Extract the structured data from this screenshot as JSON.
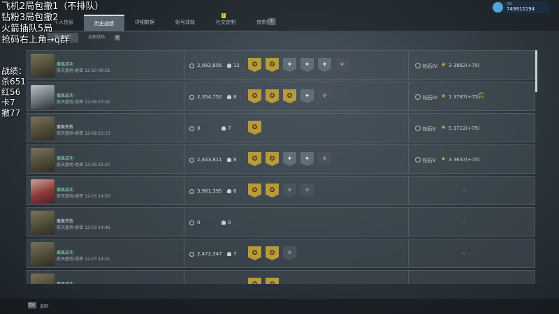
{
  "overlay_lines": [
    "飞机2局包撤1（不排队）",
    "钻粉3局包撤2",
    "火箭插队5局",
    "抢码右上角→q群"
  ],
  "stats_lines": [
    "战绩：",
    "杀651",
    "红56",
    "卡7",
    "撤77"
  ],
  "user": {
    "label": "QQ",
    "id": "749912194"
  },
  "tabs": [
    "个人信息",
    "历史战绩",
    "详细数据",
    "账号成就",
    "社交定制",
    "借贵档案"
  ],
  "subtabs": [
    "烽火地带",
    "全面战场"
  ],
  "footer": {
    "esc_key": "Esc",
    "label": "返回"
  },
  "matches": [
    {
      "avatar": "soldier",
      "status": "撤离成功",
      "map": "航天基地-绝密",
      "date": "12-10 00:01",
      "money": "2,092,856",
      "kills": "12",
      "badges": [
        "gold",
        "gold",
        "silver",
        "silver",
        "silver",
        "dark"
      ],
      "rank": "钻石IV",
      "stars": "3",
      "points": "3862(+75)",
      "chevrons": false
    },
    {
      "avatar": "mask",
      "status": "撤离成功",
      "map": "航天基地-绝密",
      "date": "12-09 23:32",
      "money": "2,354,752",
      "kills": "8",
      "badges": [
        "gold",
        "gold",
        "gold",
        "silver",
        "dark"
      ],
      "rank": "钻石IV",
      "stars": "1",
      "points": "3787(+75)",
      "chevrons": true
    },
    {
      "avatar": "soldier",
      "status": "撤离失败",
      "map": "航天基地-绝密",
      "date": "12-09 23:13",
      "money": "0",
      "kills": "7",
      "badges": [
        "gold"
      ],
      "rank": "钻石V",
      "stars": "5",
      "points": "3712(+75)",
      "chevrons": false
    },
    {
      "avatar": "soldier",
      "status": "撤离成功",
      "map": "航天基地-绝密",
      "date": "12-09 22:37",
      "money": "2,443,811",
      "kills": "8",
      "badges": [
        "gold",
        "gold",
        "silver",
        "silver",
        "dark"
      ],
      "rank": "钻石V",
      "stars": "3",
      "points": "3637(+75)",
      "chevrons": false
    },
    {
      "avatar": "girl",
      "status": "撤离成功",
      "map": "航天基地-绝密",
      "date": "12-03 14:50",
      "money": "3,961,395",
      "kills": "6",
      "badges": [
        "gold",
        "gold",
        "dark",
        "dark"
      ],
      "rank": "",
      "stars": "",
      "points": "--",
      "chevrons": false
    },
    {
      "avatar": "soldier",
      "status": "撤离失败",
      "map": "航天基地-绝密",
      "date": "12-03 14:46",
      "money": "0",
      "kills": "0",
      "badges": [],
      "rank": "",
      "stars": "",
      "points": "--",
      "chevrons": false
    },
    {
      "avatar": "soldier",
      "status": "撤离成功",
      "map": "航天基地-绝密",
      "date": "12-03 14:21",
      "money": "2,472,347",
      "kills": "7",
      "badges": [
        "gold",
        "gold",
        "dark"
      ],
      "rank": "",
      "stars": "",
      "points": "--",
      "chevrons": false
    },
    {
      "avatar": "soldier",
      "status": "撤离成功",
      "map": "",
      "date": "",
      "money": "",
      "kills": "",
      "badges": [
        "gold",
        "gold"
      ],
      "rank": "",
      "stars": "",
      "points": "",
      "chevrons": false
    }
  ]
}
